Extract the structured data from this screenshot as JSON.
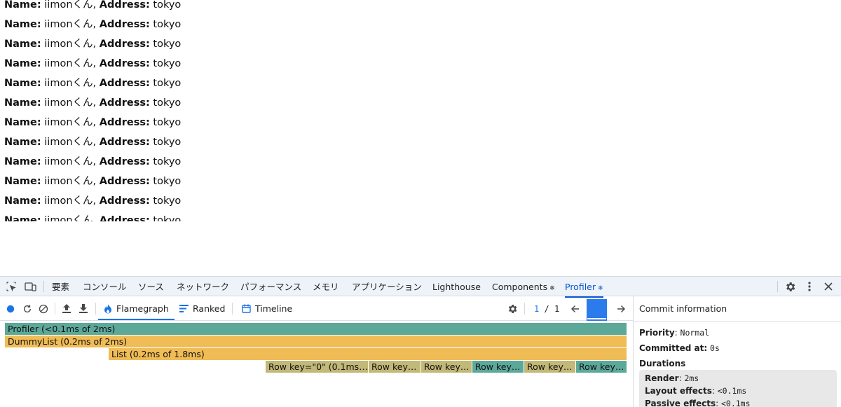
{
  "page": {
    "name_label": "Name:",
    "name_value": " iimonくん,",
    "address_label": "Address:",
    "address_value": " tokyo"
  },
  "devtools": {
    "tabs": [
      "要素",
      "コンソール",
      "ソース",
      "ネットワーク",
      "パフォーマンス",
      "メモリ",
      "アプリケーション",
      "Lighthouse",
      "Components",
      "Profiler"
    ],
    "active_tab": "Profiler",
    "icons": {
      "inspect": "inspect-element-icon",
      "device": "device-toolbar-icon",
      "settings": "gear-icon",
      "more": "more-vert-icon",
      "close": "close-icon"
    }
  },
  "profiler": {
    "views": [
      "Flamegraph",
      "Ranked",
      "Timeline"
    ],
    "active_view": "Flamegraph",
    "commit_current": "1",
    "commit_sep": "/",
    "commit_total": "1",
    "flame": [
      {
        "label": "Profiler (<0.1ms of 2ms)",
        "color": "#5ca99a"
      },
      {
        "label": "DummyList (0.2ms of 2ms)",
        "color": "#f0bc56"
      },
      {
        "label": "List (0.2ms of 1.8ms)",
        "color": "#f0bc56"
      },
      {
        "label": "Row key=\"0\" (0.1ms of...",
        "color": "#c2b877"
      },
      {
        "label": "Row key=...",
        "color": "#c2b877"
      },
      {
        "label": "Row key=...",
        "color": "#c2b877"
      },
      {
        "label": "Row key=...",
        "color": "#5ca99a"
      },
      {
        "label": "Row key=...",
        "color": "#c2b877"
      },
      {
        "label": "Row key=...",
        "color": "#5ca99a"
      }
    ],
    "accent": "#1a73e8"
  },
  "commit_info": {
    "title": "Commit information",
    "priority_label": "Priority",
    "priority_value": "Normal",
    "committed_label": "Committed at:",
    "committed_value": "0s",
    "durations_label": "Durations",
    "render_label": "Render",
    "render_value": "2ms",
    "layout_label": "Layout effects",
    "layout_value": "<0.1ms",
    "passive_label": "Passive effects",
    "passive_value": "<0.1ms"
  }
}
